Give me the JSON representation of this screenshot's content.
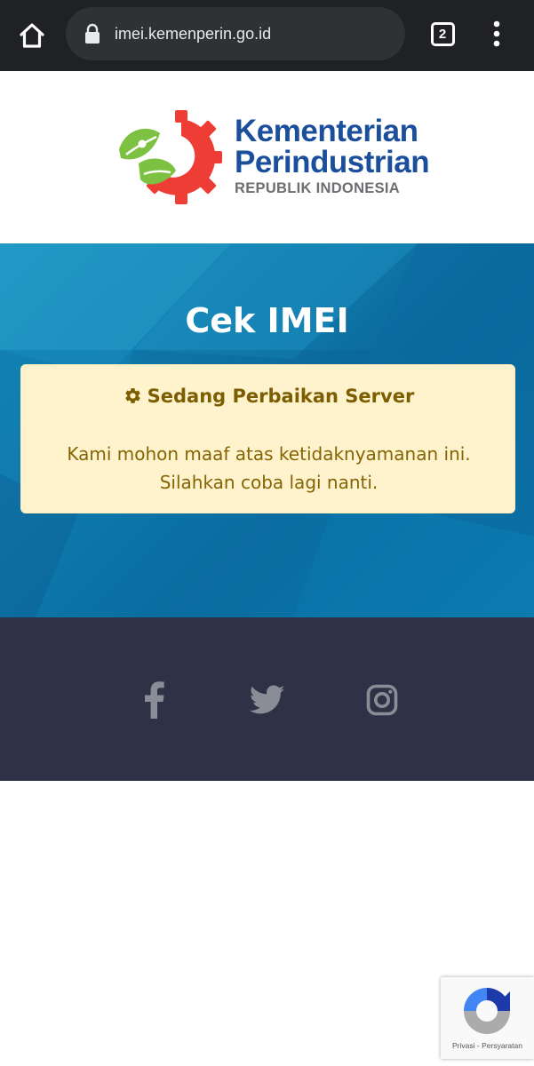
{
  "browser": {
    "url": "imei.kemenperin.go.id",
    "tab_count": "2",
    "icons": {
      "home": "home-icon",
      "lock": "lock-icon",
      "tabs": "tab-switcher-icon",
      "menu": "kebab-menu-icon"
    }
  },
  "header": {
    "logo": {
      "line1": "Kementerian",
      "line2": "Perindustrian",
      "line3": "REPUBLIK INDONESIA",
      "colors": {
        "text_primary": "#1b4f9c",
        "text_secondary": "#6d6e71",
        "gear": "#ee3d35",
        "leaf": "#7cc142"
      }
    }
  },
  "hero": {
    "title": "Cek IMEI",
    "alert": {
      "icon": "gear-icon",
      "heading": "Sedang Perbaikan Server",
      "line1": "Kami mohon maaf atas ketidaknyamanan ini.",
      "line2": "Silahkan coba lagi nanti.",
      "colors": {
        "background": "#fff3cd",
        "text": "#856404"
      }
    }
  },
  "footer": {
    "social": [
      {
        "icon": "facebook-icon"
      },
      {
        "icon": "twitter-icon"
      },
      {
        "icon": "instagram-icon"
      }
    ],
    "colors": {
      "background": "#2e3247",
      "icon": "#8b8d96"
    }
  },
  "recaptcha": {
    "privacy": "Privasi",
    "separator": "-",
    "terms": "Persyaratan"
  }
}
